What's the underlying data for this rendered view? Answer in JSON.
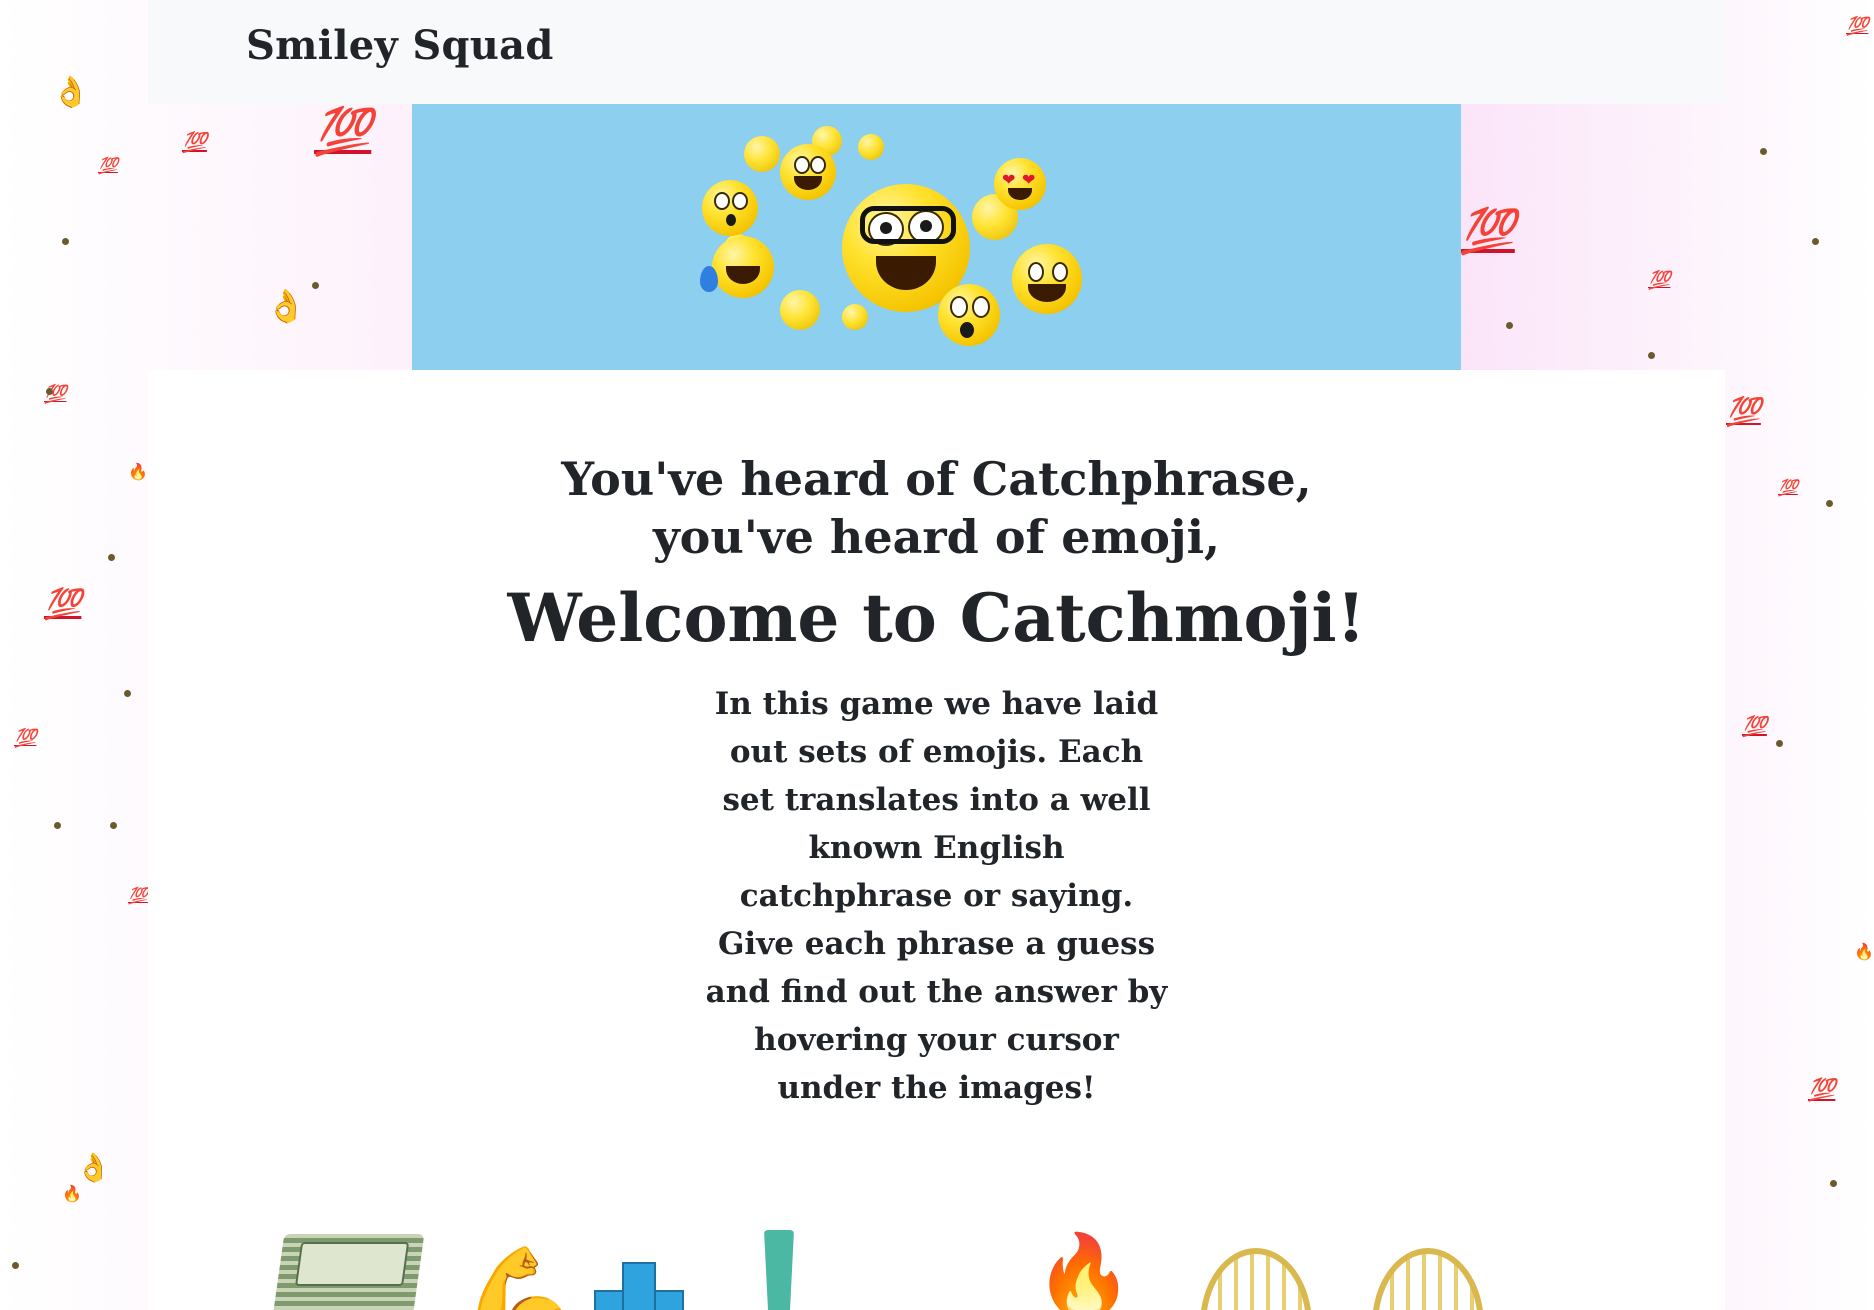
{
  "navbar": {
    "brand": "Smiley Squad"
  },
  "banner": {
    "image_alt": "emoji group banner"
  },
  "intro": {
    "line1": "You've heard of Catchphrase,",
    "line2": "you've heard of emoji,",
    "welcome": "Welcome to Catchmoji!",
    "description": "In this game we have laid out sets of emojis. Each set translates into a well known English catchphrase or saying. Give each phrase a guess and find out the answer by hovering your cursor under the images!"
  },
  "emoji_row": {
    "icons": [
      "money-icon",
      "flexed-biceps-icon",
      "plus-icon",
      "exclamation-icon",
      "fire-icon",
      "playground-slide-icon",
      "playground-slide-icon"
    ]
  },
  "colors": {
    "banner_bg": "#8ccfee",
    "navbar_bg": "#f8f9fa",
    "text": "#212529",
    "background_pink": "#f6c9f2"
  },
  "background": {
    "hundred_label": "100",
    "fire_glyph": "🔥",
    "ok_glyph": "👌"
  }
}
